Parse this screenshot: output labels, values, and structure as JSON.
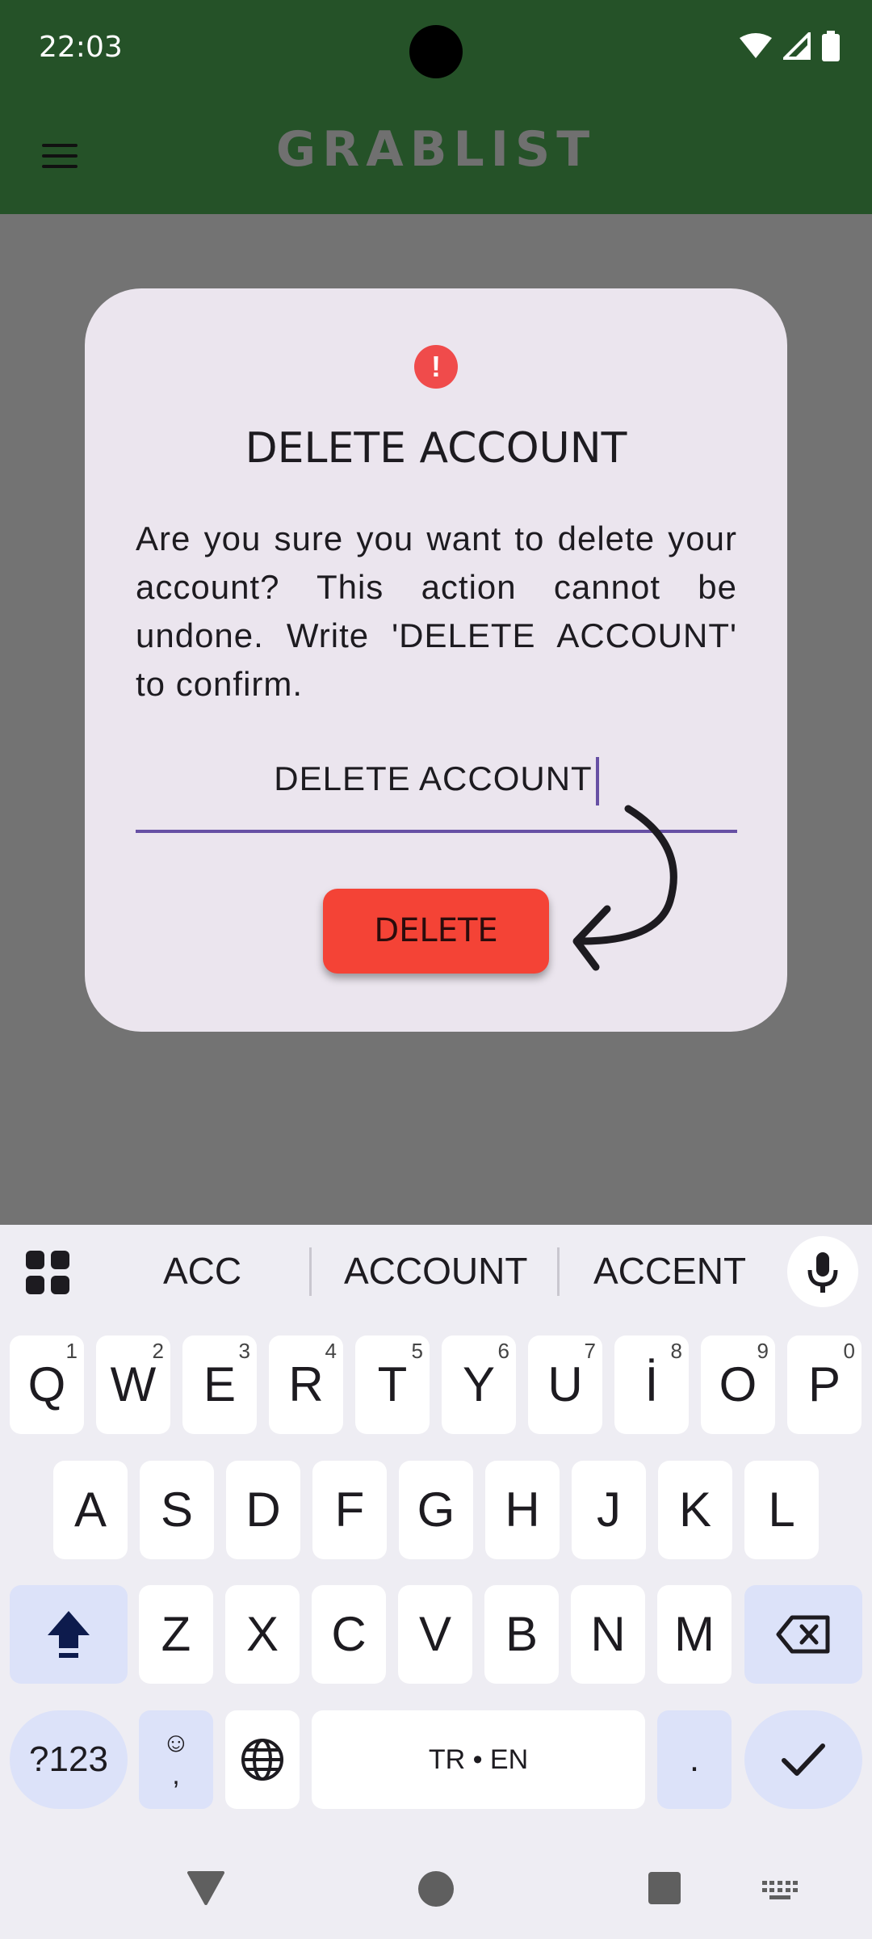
{
  "status_bar": {
    "time": "22:03"
  },
  "app_bar": {
    "title": "GRABLIST"
  },
  "dialog": {
    "icon": "!",
    "title": "DELETE ACCOUNT",
    "message": "Are you sure you want to delete your account? This action cannot be undone. Write 'DELETE ACCOUNT' to confirm.",
    "input_value": "DELETE ACCOUNT",
    "delete_label": "DELETE"
  },
  "keyboard": {
    "suggestions": [
      "ACC",
      "ACCOUNT",
      "ACCENT"
    ],
    "row1": [
      {
        "k": "Q",
        "h": "1"
      },
      {
        "k": "W",
        "h": "2"
      },
      {
        "k": "E",
        "h": "3"
      },
      {
        "k": "R",
        "h": "4"
      },
      {
        "k": "T",
        "h": "5"
      },
      {
        "k": "Y",
        "h": "6"
      },
      {
        "k": "U",
        "h": "7"
      },
      {
        "k": "İ",
        "h": "8"
      },
      {
        "k": "O",
        "h": "9"
      },
      {
        "k": "P",
        "h": "0"
      }
    ],
    "row2": [
      "A",
      "S",
      "D",
      "F",
      "G",
      "H",
      "J",
      "K",
      "L"
    ],
    "row3": [
      "Z",
      "X",
      "C",
      "V",
      "B",
      "N",
      "M"
    ],
    "symbols_label": "?123",
    "emoji_label": "☺\n,",
    "space_label": "TR • EN",
    "period_label": "."
  },
  "colors": {
    "app_bar": "#255228",
    "scrim": "#737373",
    "dialog_bg": "#ebe5ee",
    "danger": "#f44336",
    "accent": "#6750a4"
  }
}
